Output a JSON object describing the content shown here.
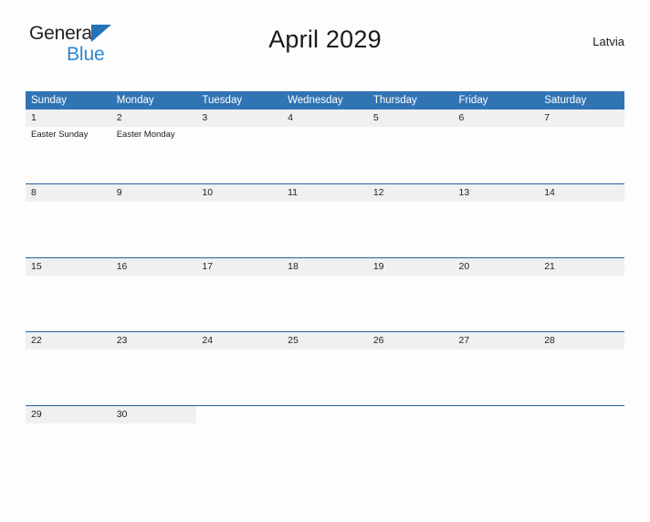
{
  "brand": {
    "name_part1": "General",
    "name_part2": "Blue"
  },
  "header": {
    "title": "April 2029",
    "region": "Latvia"
  },
  "colors": {
    "header_blue": "#3174b4",
    "row_divider": "#2a6099",
    "daynum_band": "#f0f0f0",
    "logo_blue": "#2e86d0",
    "page_background": "#fdfdfd"
  },
  "calendar": {
    "weekday_headers": [
      "Sunday",
      "Monday",
      "Tuesday",
      "Wednesday",
      "Thursday",
      "Friday",
      "Saturday"
    ],
    "weeks": [
      [
        {
          "day": "1",
          "events": [
            "Easter Sunday"
          ]
        },
        {
          "day": "2",
          "events": [
            "Easter Monday"
          ]
        },
        {
          "day": "3",
          "events": []
        },
        {
          "day": "4",
          "events": []
        },
        {
          "day": "5",
          "events": []
        },
        {
          "day": "6",
          "events": []
        },
        {
          "day": "7",
          "events": []
        }
      ],
      [
        {
          "day": "8",
          "events": []
        },
        {
          "day": "9",
          "events": []
        },
        {
          "day": "10",
          "events": []
        },
        {
          "day": "11",
          "events": []
        },
        {
          "day": "12",
          "events": []
        },
        {
          "day": "13",
          "events": []
        },
        {
          "day": "14",
          "events": []
        }
      ],
      [
        {
          "day": "15",
          "events": []
        },
        {
          "day": "16",
          "events": []
        },
        {
          "day": "17",
          "events": []
        },
        {
          "day": "18",
          "events": []
        },
        {
          "day": "19",
          "events": []
        },
        {
          "day": "20",
          "events": []
        },
        {
          "day": "21",
          "events": []
        }
      ],
      [
        {
          "day": "22",
          "events": []
        },
        {
          "day": "23",
          "events": []
        },
        {
          "day": "24",
          "events": []
        },
        {
          "day": "25",
          "events": []
        },
        {
          "day": "26",
          "events": []
        },
        {
          "day": "27",
          "events": []
        },
        {
          "day": "28",
          "events": []
        }
      ],
      [
        {
          "day": "29",
          "events": []
        },
        {
          "day": "30",
          "events": []
        },
        {
          "day": "",
          "events": []
        },
        {
          "day": "",
          "events": []
        },
        {
          "day": "",
          "events": []
        },
        {
          "day": "",
          "events": []
        },
        {
          "day": "",
          "events": []
        }
      ]
    ]
  }
}
